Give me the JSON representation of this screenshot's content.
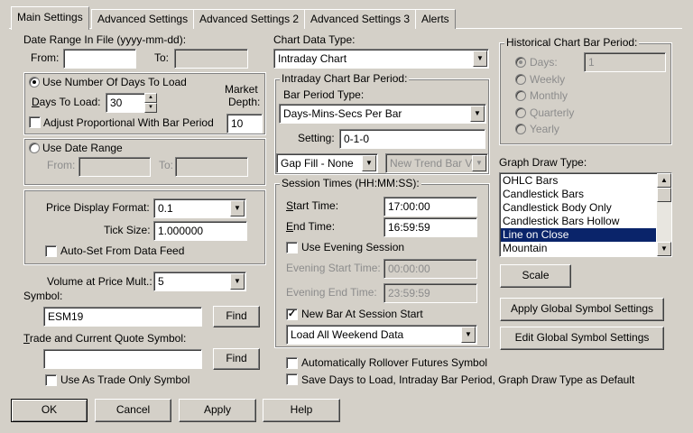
{
  "tabs": [
    "Main Settings",
    "Advanced Settings",
    "Advanced Settings 2",
    "Advanced Settings 3",
    "Alerts"
  ],
  "date_range": {
    "title": "Date Range In File (yyyy-mm-dd):",
    "from_label": "From:",
    "from_value": "",
    "to_label": "To:",
    "to_value": ""
  },
  "days_group": {
    "use_days_label": "Use Number Of Days To Load",
    "days_to_load_label": "Days To Load:",
    "days_to_load_value": "30",
    "market_depth_label_1": "Market",
    "market_depth_label_2": "Depth:",
    "market_depth_value": "10",
    "adjust_label": "Adjust Proportional With Bar Period"
  },
  "date_range_group": {
    "use_date_range_label": "Use Date Range",
    "from_label": "From:",
    "to_label": "To:"
  },
  "price_group": {
    "price_display_label": "Price Display Format:",
    "price_display_value": "0.1",
    "tick_size_label": "Tick Size:",
    "tick_size_value": "1.000000",
    "autoset_label": "Auto-Set From Data Feed"
  },
  "volume": {
    "label": "Volume at Price Mult.:",
    "value": "5"
  },
  "symbol": {
    "label": "Symbol:",
    "value": "ESM19",
    "find_label": "Find"
  },
  "trade_symbol": {
    "label": "Trade and Current Quote Symbol:",
    "value": "",
    "find_label": "Find",
    "trade_only_label": "Use As Trade Only Symbol"
  },
  "chart_data_type": {
    "label": "Chart Data Type:",
    "value": "Intraday Chart"
  },
  "intraday": {
    "title": "Intraday Chart Bar Period:",
    "bar_period_type_label": "Bar Period Type:",
    "bar_period_type_value": "Days-Mins-Secs Per Bar",
    "setting_label": "Setting:",
    "setting_value": "0-1-0",
    "gap_fill_value": "Gap Fill - None",
    "new_trend_value": "New Trend Bar V"
  },
  "session": {
    "title": "Session Times (HH:MM:SS):",
    "start_label": "Start Time:",
    "start_value": "17:00:00",
    "end_label": "End Time:",
    "end_value": "16:59:59",
    "use_evening_label": "Use Evening Session",
    "evening_start_label": "Evening Start Time:",
    "evening_start_value": "00:00:00",
    "evening_end_label": "Evening End Time:",
    "evening_end_value": "23:59:59",
    "new_bar_label": "New Bar At Session Start",
    "weekend_value": "Load All Weekend Data"
  },
  "rollover_label": "Automatically Rollover Futures Symbol",
  "save_defaults_label": "Save Days to Load, Intraday Bar Period, Graph Draw Type as Default",
  "historical": {
    "title": "Historical Chart Bar Period:",
    "days_label": "Days:",
    "days_value": "1",
    "weekly_label": "Weekly",
    "monthly_label": "Monthly",
    "quarterly_label": "Quarterly",
    "yearly_label": "Yearly"
  },
  "graph_draw": {
    "label": "Graph Draw Type:",
    "items": [
      "OHLC Bars",
      "Candlestick Bars",
      "Candlestick Body Only",
      "Candlestick Bars Hollow",
      "Line on Close",
      "Mountain"
    ],
    "selected": "Line on Close"
  },
  "scale_label": "Scale",
  "apply_global_label": "Apply Global Symbol Settings",
  "edit_global_label": "Edit Global Symbol Settings",
  "bottom_buttons": {
    "ok": "OK",
    "cancel": "Cancel",
    "apply": "Apply",
    "help": "Help"
  },
  "colors": {
    "selection": "#0a246a",
    "face": "#d4d0c8"
  }
}
